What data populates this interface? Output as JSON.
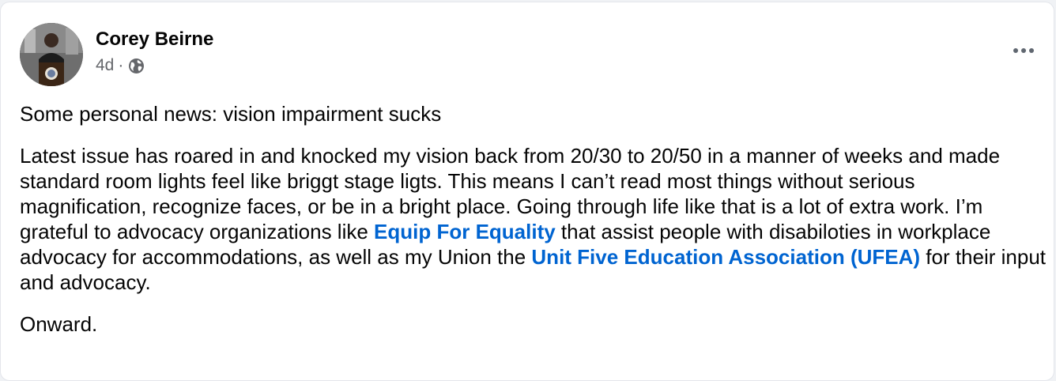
{
  "post": {
    "author": "Corey Beirne",
    "time": "4d",
    "separator": "·",
    "audience_icon": "globe-icon",
    "more_icon": "more-options-icon",
    "paragraph_1": "Some personal news: vision impairment sucks",
    "paragraph_2": {
      "text_1": "Latest issue has roared in and knocked my vision back from 20/30 to 20/50 in a manner of weeks and made standard room lights feel like briggt stage ligts. This means I can’t read most things without serious magnification, recognize faces, or be in a bright place. Going through life like that is a lot of extra work. I’m grateful to advocacy organizations like ",
      "link_1": "Equip For Equality",
      "text_2": " that assist people with disabiloties in workplace advocacy for accommodations, as well as my Union the ",
      "link_2": "Unit Five Education Association (UFEA)",
      "text_3": " for their input and advocacy."
    },
    "paragraph_3": "Onward."
  },
  "colors": {
    "link": "#0064d1",
    "text": "#050505",
    "secondary": "#65676b"
  }
}
